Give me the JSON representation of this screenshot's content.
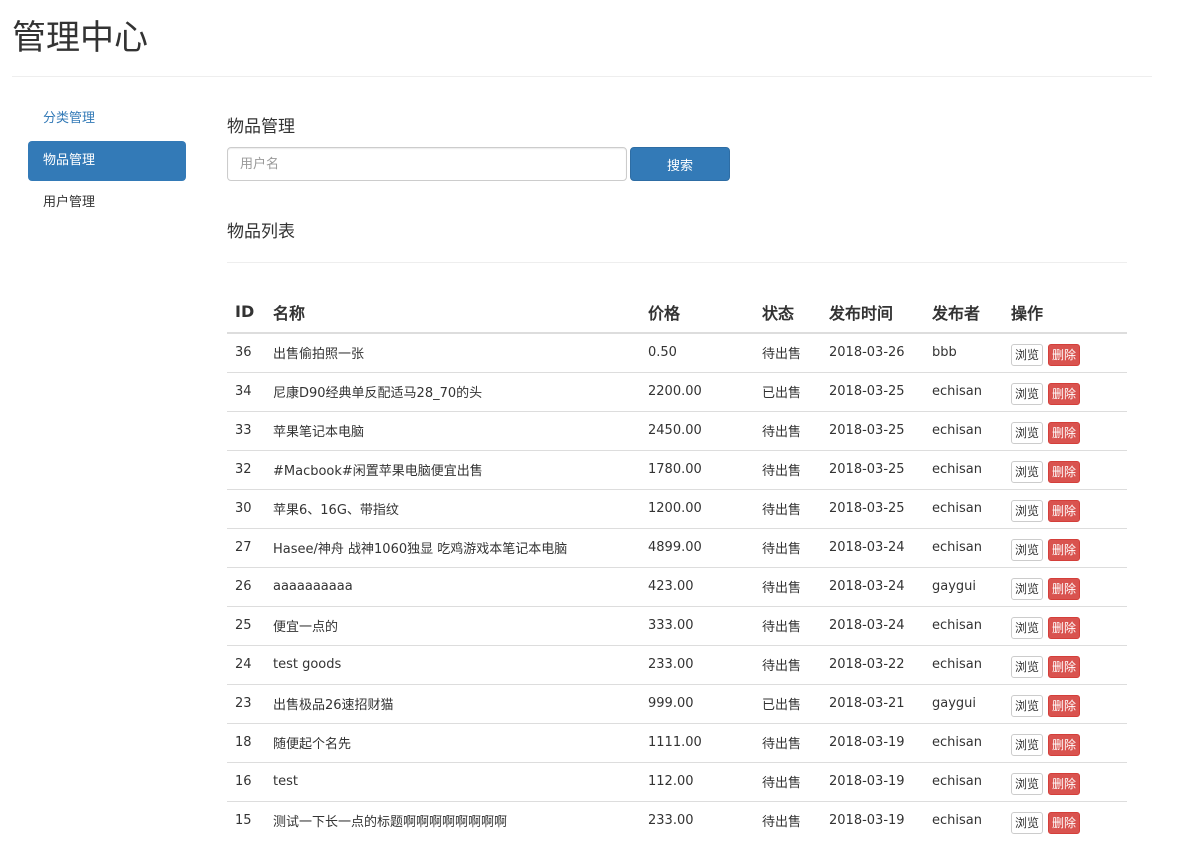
{
  "page": {
    "title": "管理中心"
  },
  "sidebar": {
    "items": [
      {
        "label": "分类管理"
      },
      {
        "label": "物品管理"
      },
      {
        "label": "用户管理"
      }
    ]
  },
  "main": {
    "section_title": "物品管理",
    "search": {
      "placeholder": "用户名",
      "value": "",
      "button_label": "搜索"
    },
    "list_title": "物品列表"
  },
  "table": {
    "headers": [
      "ID",
      "名称",
      "价格",
      "状态",
      "发布时间",
      "发布者",
      "操作"
    ],
    "view_label": "浏览",
    "delete_label": "删除",
    "rows": [
      {
        "id": "36",
        "name": "出售偷拍照一张",
        "price": "0.50",
        "status": "待出售",
        "sold": false,
        "time": "2018-03-26",
        "publisher": "bbb"
      },
      {
        "id": "34",
        "name": "尼康D90经典单反配适马28_70的头",
        "price": "2200.00",
        "status": "已出售",
        "sold": true,
        "time": "2018-03-25",
        "publisher": "echisan"
      },
      {
        "id": "33",
        "name": "苹果笔记本电脑",
        "price": "2450.00",
        "status": "待出售",
        "sold": false,
        "time": "2018-03-25",
        "publisher": "echisan"
      },
      {
        "id": "32",
        "name": "#Macbook#闲置苹果电脑便宜出售",
        "price": "1780.00",
        "status": "待出售",
        "sold": false,
        "time": "2018-03-25",
        "publisher": "echisan"
      },
      {
        "id": "30",
        "name": "苹果6、16G、带指纹",
        "price": "1200.00",
        "status": "待出售",
        "sold": false,
        "time": "2018-03-25",
        "publisher": "echisan"
      },
      {
        "id": "27",
        "name": "Hasee/神舟 战神1060独显 吃鸡游戏本笔记本电脑",
        "price": "4899.00",
        "status": "待出售",
        "sold": false,
        "time": "2018-03-24",
        "publisher": "echisan"
      },
      {
        "id": "26",
        "name": "aaaaaaaaaa",
        "price": "423.00",
        "status": "待出售",
        "sold": false,
        "time": "2018-03-24",
        "publisher": "gaygui"
      },
      {
        "id": "25",
        "name": "便宜一点的",
        "price": "333.00",
        "status": "待出售",
        "sold": false,
        "time": "2018-03-24",
        "publisher": "echisan"
      },
      {
        "id": "24",
        "name": "test goods",
        "price": "233.00",
        "status": "待出售",
        "sold": false,
        "time": "2018-03-22",
        "publisher": "echisan"
      },
      {
        "id": "23",
        "name": "出售极品26速招财猫",
        "price": "999.00",
        "status": "已出售",
        "sold": true,
        "time": "2018-03-21",
        "publisher": "gaygui"
      },
      {
        "id": "18",
        "name": "随便起个名先",
        "price": "1111.00",
        "status": "待出售",
        "sold": false,
        "time": "2018-03-19",
        "publisher": "echisan"
      },
      {
        "id": "16",
        "name": "test",
        "price": "112.00",
        "status": "待出售",
        "sold": false,
        "time": "2018-03-19",
        "publisher": "echisan"
      },
      {
        "id": "15",
        "name": "测试一下长一点的标题啊啊啊啊啊啊啊啊",
        "price": "233.00",
        "status": "待出售",
        "sold": false,
        "time": "2018-03-19",
        "publisher": "echisan"
      }
    ]
  },
  "colors": {
    "primary": "#337ab7",
    "danger": "#d9534f",
    "success": "#5cb85c"
  }
}
